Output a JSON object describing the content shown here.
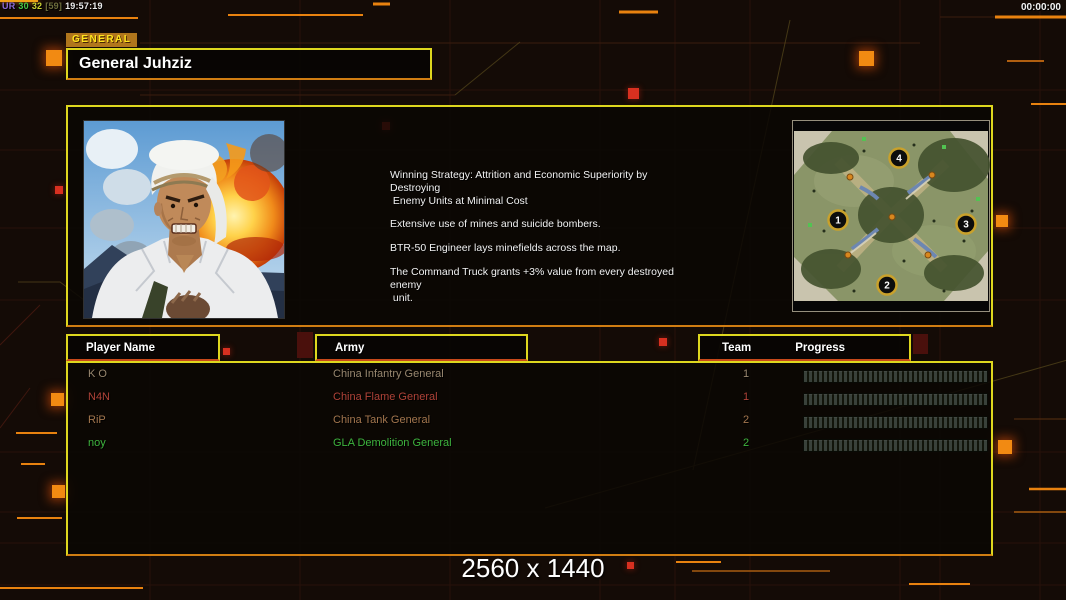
{
  "overlay": {
    "app_tag": "UR",
    "stat1": "30",
    "stat2": "32",
    "stat3": "[59]",
    "time": "19:57:19",
    "match_clock": "00:00:00"
  },
  "header": {
    "tab_label": "GENERAL",
    "general_name": "General Juhziz"
  },
  "info": {
    "strategy": [
      "Winning Strategy: Attrition and Economic Superiority by Destroying\n Enemy Units at Minimal Cost",
      "Extensive use of mines and suicide bombers.",
      "BTR-50 Engineer lays minefields across the map.",
      "The Command Truck grants +3% value from every destroyed enemy\n unit."
    ]
  },
  "map": {
    "badges": [
      "1",
      "2",
      "3",
      "4"
    ]
  },
  "table": {
    "headers": {
      "player": "Player Name",
      "army": "Army",
      "team": "Team",
      "progress": "Progress"
    }
  },
  "players": [
    {
      "name": "K O",
      "army": "China Infantry General",
      "team": "1",
      "color": "#98876f"
    },
    {
      "name": "N4N",
      "army": "China Flame General",
      "team": "1",
      "color": "#b04338"
    },
    {
      "name": "RiP",
      "army": "China Tank General",
      "team": "2",
      "color": "#a3764e"
    },
    {
      "name": "noy",
      "army": "GLA Demolition General",
      "team": "2",
      "color": "#3eb43e"
    }
  ],
  "footer": {
    "resolution": "2560 x 1440"
  },
  "colors": {
    "accent_yellow": "#ded71e",
    "accent_orange": "#e8820f"
  }
}
